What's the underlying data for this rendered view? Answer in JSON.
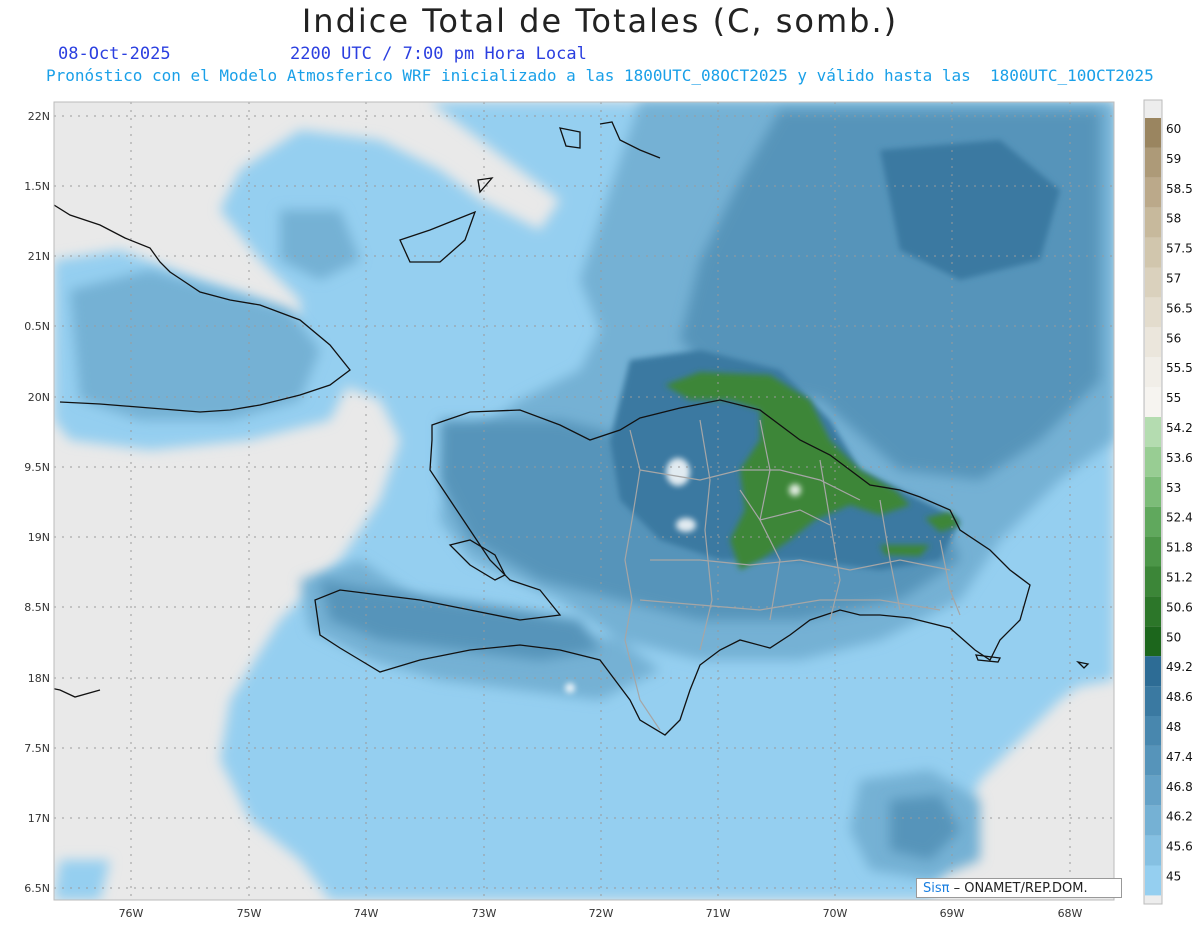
{
  "header": {
    "title": "Indice Total de Totales (C, somb.)",
    "date": "08-Oct-2025",
    "time": "2200 UTC / 7:00 pm Hora Local",
    "forecast_note": "Pronóstico con el Modelo Atmosferico WRF inicializado a las 1800UTC_08OCT2025 y válido hasta las  1800UTC_10OCT2025"
  },
  "axes": {
    "lon_labels": [
      "76W",
      "75W",
      "74W",
      "73W",
      "72W",
      "71W",
      "70W",
      "69W",
      "68W"
    ],
    "lat_labels": [
      "22N",
      "1.5N",
      "21N",
      "0.5N",
      "20N",
      "9.5N",
      "19N",
      "8.5N",
      "18N",
      "7.5N",
      "17N",
      "6.5N"
    ]
  },
  "colorbar": {
    "labels": [
      "60",
      "59",
      "58.5",
      "58",
      "57.5",
      "57",
      "56.5",
      "56",
      "55.5",
      "55",
      "54.2",
      "53.6",
      "53",
      "52.4",
      "51.8",
      "51.2",
      "50.6",
      "50",
      "49.2",
      "48.6",
      "48",
      "47.4",
      "46.8",
      "46.2",
      "45.6",
      "45"
    ],
    "colors": [
      "#9a8560",
      "#ad9a78",
      "#bba98a",
      "#c7b99c",
      "#d1c6ad",
      "#dad1bd",
      "#e3dccd",
      "#ebe6dc",
      "#f1eee8",
      "#f6f4f0",
      "#b4dcb0",
      "#98cd93",
      "#7cbc78",
      "#60a85d",
      "#4c9648",
      "#3c8638",
      "#2c7629",
      "#1c661c",
      "#2d6c95",
      "#3a79a1",
      "#4887ae",
      "#5694ba",
      "#65a2c7",
      "#75b1d4",
      "#85c0e2",
      "#95cff0"
    ]
  },
  "credit": {
    "brand": "Sisπ",
    "text": " – ONAMET/REP.DOM."
  }
}
